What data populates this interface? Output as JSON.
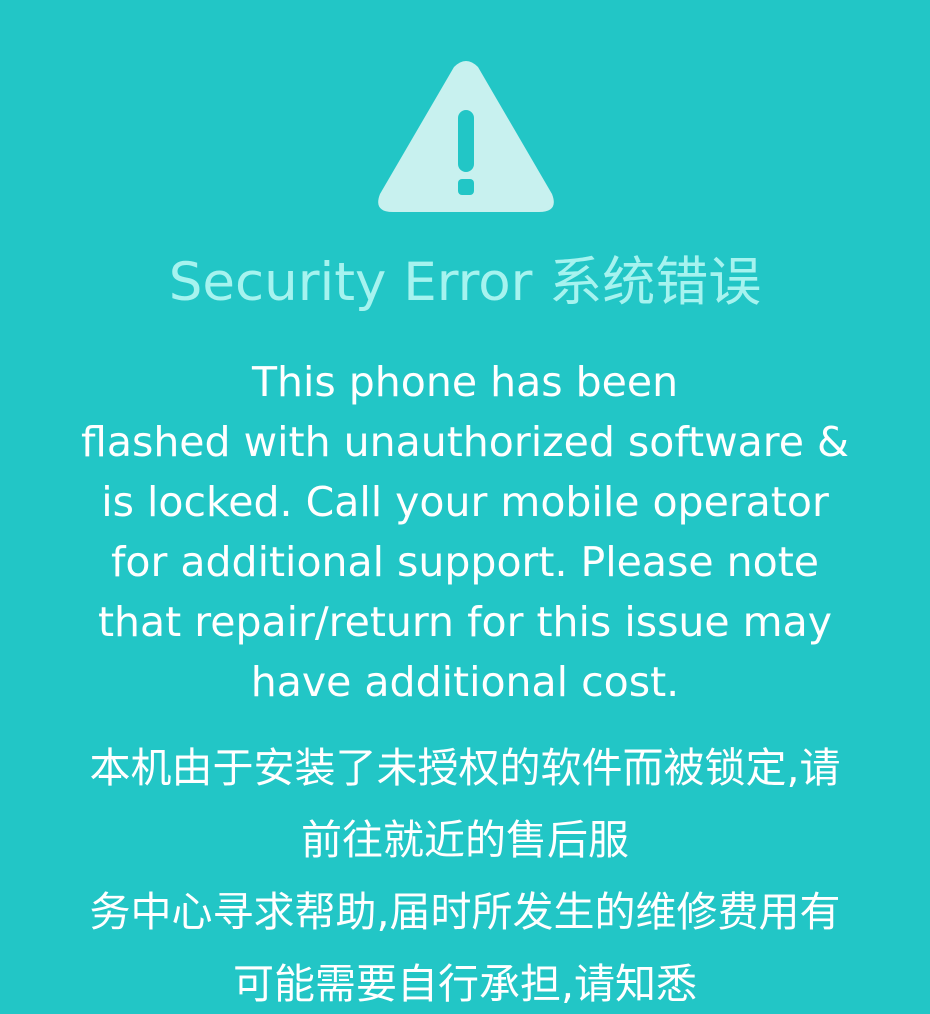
{
  "icon": "warning-triangle-icon",
  "colors": {
    "background": "#22c6c6",
    "title": "#a6f3ef",
    "icon": "#c8f1ef",
    "text": "#ffffff"
  },
  "title": "Security Error 系统错误",
  "english_message": {
    "lines": [
      "This phone has been",
      "flashed with unauthorized software &",
      "is locked. Call your mobile operator",
      "for additional support. Please note",
      "that repair/return for this issue may",
      "have additional cost."
    ]
  },
  "chinese_message": {
    "lines": [
      "本机由于安装了未授权的软件而被锁定,请",
      "前往就近的售后服",
      "务中心寻求帮助,届时所发生的维修费用有",
      "可能需要自行承担,请知悉"
    ]
  }
}
